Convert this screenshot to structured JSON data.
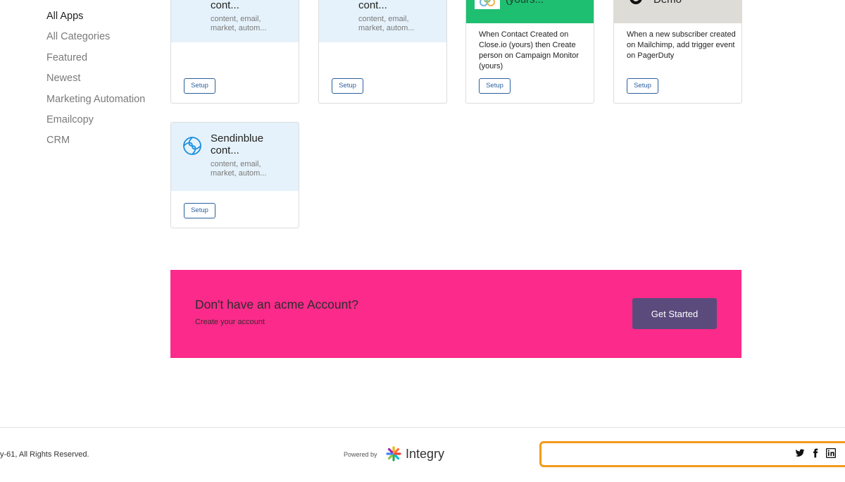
{
  "sidebar": {
    "items": [
      {
        "label": "All Apps",
        "active": true
      },
      {
        "label": "All Categories"
      },
      {
        "label": "Featured"
      },
      {
        "label": "Newest"
      },
      {
        "label": "Marketing Automation"
      },
      {
        "label": "Emailcopy"
      },
      {
        "label": "CRM"
      }
    ]
  },
  "cards": [
    {
      "title": "cont...",
      "tags_line1": "content, email,",
      "tags_line2": "market, autom...",
      "setup": "Setup"
    },
    {
      "title": "cont...",
      "tags_line1": "content, email,",
      "tags_line2": "market, autom...",
      "setup": "Setup"
    },
    {
      "title": "(yours...",
      "description": "When Contact Created on Close.io (yours) then Create person on Campaign Monitor (yours)",
      "setup": "Setup"
    },
    {
      "title": "Demo",
      "description": "When a new subscriber created on Mailchimp, add trigger event on PagerDuty",
      "setup": "Setup"
    },
    {
      "title_line1": "Sendinblue",
      "title_line2": "cont...",
      "tags_line1": "content, email,",
      "tags_line2": "market, autom...",
      "setup": "Setup"
    }
  ],
  "banner": {
    "title": "Don't have an acme Account?",
    "subtitle": "Create your account",
    "button": "Get Started"
  },
  "footer": {
    "copyright": "y-61, All Rights Reserved.",
    "powered_by": "Powered by",
    "brand": "Integry",
    "social": [
      "twitter-icon",
      "facebook-icon",
      "linkedin-icon"
    ]
  },
  "colors": {
    "card_header": "#e5f2fb",
    "green_header": "#1fbf71",
    "banner": "#fb2a8b",
    "cta": "#5b4b7d",
    "focus_outline": "#f39a1c"
  }
}
